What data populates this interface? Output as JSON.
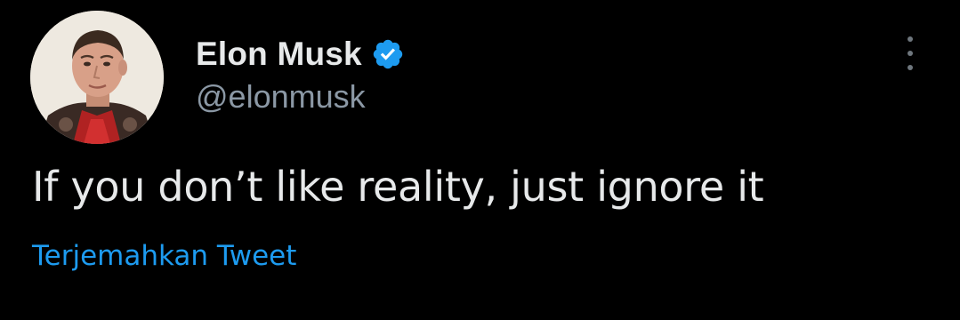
{
  "tweet": {
    "author": {
      "display_name": "Elon Musk",
      "handle": "@elonmusk",
      "verified": true
    },
    "text": "If you don’t like reality, just ignore it",
    "translate_label": "Terjemahkan Tweet"
  },
  "icons": {
    "verified": "verified-badge-icon",
    "more": "more-options-icon"
  },
  "colors": {
    "background": "#000000",
    "primary_text": "#e7e9ea",
    "secondary_text": "#8b98a5",
    "link": "#1d9bf0",
    "verified_badge": "#1d9bf0"
  }
}
